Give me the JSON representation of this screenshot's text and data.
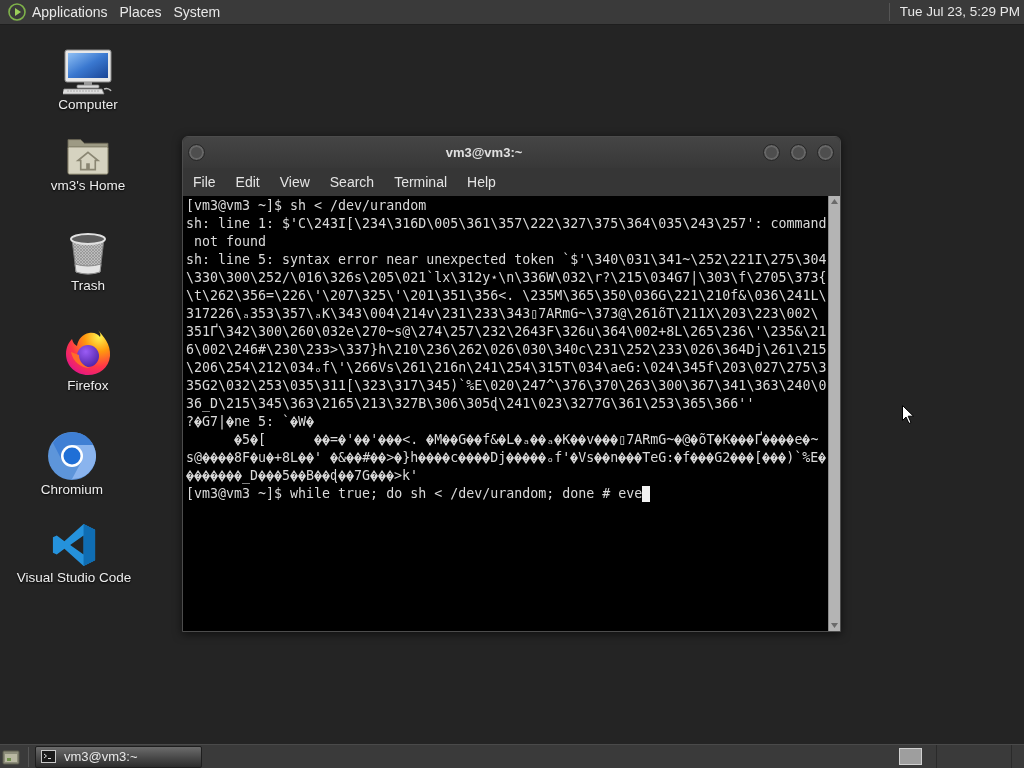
{
  "top_panel": {
    "menus": [
      "Applications",
      "Places",
      "System"
    ],
    "clock": "Tue Jul 23, 5:29 PM"
  },
  "desktop_icons": [
    {
      "label": "Computer",
      "kind": "computer"
    },
    {
      "label": "vm3's Home",
      "kind": "home"
    },
    {
      "label": "Trash",
      "kind": "trash"
    },
    {
      "label": "Firefox",
      "kind": "firefox"
    },
    {
      "label": "Chromium",
      "kind": "chromium"
    },
    {
      "label": "Visual Studio Code",
      "kind": "vscode"
    }
  ],
  "terminal_window": {
    "title": "vm3@vm3:~",
    "menu": [
      "File",
      "Edit",
      "View",
      "Search",
      "Terminal",
      "Help"
    ],
    "lines": [
      {
        "parts": [
          {
            "kind": "text",
            "text": "[vm3@vm3 ~]$ sh < /dev/urandom"
          }
        ]
      },
      {
        "parts": [
          {
            "kind": "text",
            "text": "sh: line 1: $'C\\243I[\\234\\316D\\005\\361\\357\\222\\327\\375\\364\\035\\243\\257': command"
          }
        ]
      },
      {
        "parts": [
          {
            "kind": "text",
            "text": " not found"
          }
        ]
      },
      {
        "parts": [
          {
            "kind": "text",
            "text": "sh: line 5: syntax error near unexpected token `$'\\340\\031\\341~\\252\\221I\\275\\304"
          }
        ]
      },
      {
        "parts": [
          {
            "kind": "text",
            "text": "\\330\\300\\252/\\016\\326s\\205\\021`lx\\312y⋆\\n\\336W\\032\\r?\\215\\034G7|\\303\\f\\2705\\373{"
          }
        ]
      },
      {
        "parts": [
          {
            "kind": "text",
            "text": "\\t\\262\\356=\\226\\'\\207\\325\\'\\201\\351\\356<. \\235M\\365\\350\\036G\\221\\210f&\\036\\241L\\"
          }
        ]
      },
      {
        "parts": [
          {
            "kind": "text",
            "text": "317226\\ₐ353\\357\\ₐK\\343\\004\\214v\\231\\233\\343▯7ARmG~\\373@\\261õT\\211X\\203\\223\\002\\"
          }
        ]
      },
      {
        "parts": [
          {
            "kind": "text",
            "text": "351Ґ\\342\\300\\260\\032e\\270~s@\\274\\257\\232\\2643F\\326u\\364\\002+8L\\265\\236\\'\\235&\\21"
          }
        ]
      },
      {
        "parts": [
          {
            "kind": "text",
            "text": "6\\002\\246#\\230\\233>\\337}h\\210\\236\\262\\026\\030\\340c\\231\\252\\233\\026\\364Dj\\261\\215"
          }
        ]
      },
      {
        "parts": [
          {
            "kind": "text",
            "text": "\\206\\254\\212\\034ₒf\\'\\266Vs\\261\\216n\\241\\254\\315T\\034\\aeG:\\024\\345f\\203\\027\\275\\3"
          }
        ]
      },
      {
        "parts": [
          {
            "kind": "text",
            "text": "35G2\\032\\253\\035\\311[\\323\\317\\345)`%E\\020\\247^\\376\\370\\263\\300\\367\\341\\363\\240\\0"
          }
        ]
      },
      {
        "parts": [
          {
            "kind": "text",
            "text": "36_D\\215\\345\\363\\2165\\213\\327B\\306\\305ɖ\\241\\023\\3277G\\361\\253\\365\\366''"
          }
        ]
      },
      {
        "parts": [
          {
            "kind": "text",
            "text": "?"
          },
          {
            "kind": "glyph"
          },
          {
            "kind": "text",
            "text": "G7|"
          },
          {
            "kind": "glyph"
          },
          {
            "kind": "text",
            "text": "ne 5: `"
          },
          {
            "kind": "glyph"
          },
          {
            "kind": "text",
            "text": "W"
          },
          {
            "kind": "glyph"
          }
        ]
      },
      {
        "parts": [
          {
            "kind": "tab"
          },
          {
            "kind": "glyph"
          },
          {
            "kind": "text",
            "text": "5"
          },
          {
            "kind": "glyph"
          },
          {
            "kind": "text",
            "text": "[      "
          },
          {
            "kind": "glyph"
          },
          {
            "kind": "glyph"
          },
          {
            "kind": "text",
            "text": "="
          },
          {
            "kind": "glyph"
          },
          {
            "kind": "text",
            "text": "'"
          },
          {
            "kind": "glyph"
          },
          {
            "kind": "glyph"
          },
          {
            "kind": "text",
            "text": "'"
          },
          {
            "kind": "glyph"
          },
          {
            "kind": "glyph"
          },
          {
            "kind": "glyph"
          },
          {
            "kind": "text",
            "text": "<. "
          },
          {
            "kind": "glyph"
          },
          {
            "kind": "text",
            "text": "M"
          },
          {
            "kind": "glyph"
          },
          {
            "kind": "glyph"
          },
          {
            "kind": "text",
            "text": "G"
          },
          {
            "kind": "glyph"
          },
          {
            "kind": "glyph"
          },
          {
            "kind": "text",
            "text": "f&"
          },
          {
            "kind": "glyph"
          },
          {
            "kind": "text",
            "text": "L"
          },
          {
            "kind": "glyph"
          },
          {
            "kind": "text",
            "text": "ₐ"
          },
          {
            "kind": "glyph"
          },
          {
            "kind": "glyph"
          },
          {
            "kind": "text",
            "text": "ₐ"
          },
          {
            "kind": "glyph"
          },
          {
            "kind": "text",
            "text": "K"
          },
          {
            "kind": "glyph"
          },
          {
            "kind": "glyph"
          },
          {
            "kind": "text",
            "text": "v"
          },
          {
            "kind": "glyph"
          },
          {
            "kind": "glyph"
          },
          {
            "kind": "glyph"
          },
          {
            "kind": "text",
            "text": "▯7ARmG~"
          },
          {
            "kind": "glyph"
          },
          {
            "kind": "text",
            "text": "@"
          },
          {
            "kind": "glyph"
          },
          {
            "kind": "text",
            "text": "õT"
          },
          {
            "kind": "glyph"
          },
          {
            "kind": "text",
            "text": "K"
          },
          {
            "kind": "glyph"
          },
          {
            "kind": "glyph"
          },
          {
            "kind": "glyph"
          },
          {
            "kind": "text",
            "text": "Ґ"
          },
          {
            "kind": "glyph"
          },
          {
            "kind": "glyph"
          },
          {
            "kind": "glyph"
          },
          {
            "kind": "glyph"
          },
          {
            "kind": "text",
            "text": "e"
          },
          {
            "kind": "glyph"
          },
          {
            "kind": "text",
            "text": "~"
          }
        ]
      },
      {
        "parts": [
          {
            "kind": "text",
            "text": "s@"
          },
          {
            "kind": "glyph"
          },
          {
            "kind": "glyph"
          },
          {
            "kind": "glyph"
          },
          {
            "kind": "glyph"
          },
          {
            "kind": "text",
            "text": "8F"
          },
          {
            "kind": "glyph"
          },
          {
            "kind": "text",
            "text": "u"
          },
          {
            "kind": "glyph"
          },
          {
            "kind": "text",
            "text": "+8L"
          },
          {
            "kind": "glyph"
          },
          {
            "kind": "glyph"
          },
          {
            "kind": "text",
            "text": "' "
          },
          {
            "kind": "glyph"
          },
          {
            "kind": "text",
            "text": "&"
          },
          {
            "kind": "glyph"
          },
          {
            "kind": "glyph"
          },
          {
            "kind": "text",
            "text": "#"
          },
          {
            "kind": "glyph"
          },
          {
            "kind": "glyph"
          },
          {
            "kind": "text",
            "text": ">"
          },
          {
            "kind": "glyph"
          },
          {
            "kind": "text",
            "text": "}h"
          },
          {
            "kind": "glyph"
          },
          {
            "kind": "glyph"
          },
          {
            "kind": "glyph"
          },
          {
            "kind": "glyph"
          },
          {
            "kind": "text",
            "text": "c"
          },
          {
            "kind": "glyph"
          },
          {
            "kind": "glyph"
          },
          {
            "kind": "glyph"
          },
          {
            "kind": "glyph"
          },
          {
            "kind": "text",
            "text": "Dj"
          },
          {
            "kind": "glyph"
          },
          {
            "kind": "glyph"
          },
          {
            "kind": "glyph"
          },
          {
            "kind": "glyph"
          },
          {
            "kind": "glyph"
          },
          {
            "kind": "text",
            "text": "ₒf'"
          },
          {
            "kind": "glyph"
          },
          {
            "kind": "text",
            "text": "Vs"
          },
          {
            "kind": "glyph"
          },
          {
            "kind": "glyph"
          },
          {
            "kind": "text",
            "text": "n"
          },
          {
            "kind": "glyph"
          },
          {
            "kind": "glyph"
          },
          {
            "kind": "glyph"
          },
          {
            "kind": "text",
            "text": "TeG:"
          },
          {
            "kind": "glyph"
          },
          {
            "kind": "text",
            "text": "f"
          },
          {
            "kind": "glyph"
          },
          {
            "kind": "glyph"
          },
          {
            "kind": "glyph"
          },
          {
            "kind": "text",
            "text": "G2"
          },
          {
            "kind": "glyph"
          },
          {
            "kind": "glyph"
          },
          {
            "kind": "glyph"
          },
          {
            "kind": "text",
            "text": "["
          },
          {
            "kind": "glyph"
          },
          {
            "kind": "glyph"
          },
          {
            "kind": "glyph"
          },
          {
            "kind": "text",
            "text": ")`%E"
          },
          {
            "kind": "glyph"
          }
        ]
      },
      {
        "parts": [
          {
            "kind": "glyph"
          },
          {
            "kind": "glyph"
          },
          {
            "kind": "glyph"
          },
          {
            "kind": "glyph"
          },
          {
            "kind": "glyph"
          },
          {
            "kind": "glyph"
          },
          {
            "kind": "glyph"
          },
          {
            "kind": "text",
            "text": "_D"
          },
          {
            "kind": "glyph"
          },
          {
            "kind": "glyph"
          },
          {
            "kind": "glyph"
          },
          {
            "kind": "text",
            "text": "5"
          },
          {
            "kind": "glyph"
          },
          {
            "kind": "glyph"
          },
          {
            "kind": "text",
            "text": "B"
          },
          {
            "kind": "glyph"
          },
          {
            "kind": "glyph"
          },
          {
            "kind": "text",
            "text": "ɖ"
          },
          {
            "kind": "glyph"
          },
          {
            "kind": "glyph"
          },
          {
            "kind": "text",
            "text": "7G"
          },
          {
            "kind": "glyph"
          },
          {
            "kind": "glyph"
          },
          {
            "kind": "glyph"
          },
          {
            "kind": "text",
            "text": ">k'"
          }
        ]
      },
      {
        "parts": [
          {
            "kind": "text",
            "text": "[vm3@vm3 ~]$ while true; do sh < /dev/urandom; done # eve"
          }
        ]
      }
    ]
  },
  "taskbar": {
    "window_button": "vm3@vm3:~"
  }
}
